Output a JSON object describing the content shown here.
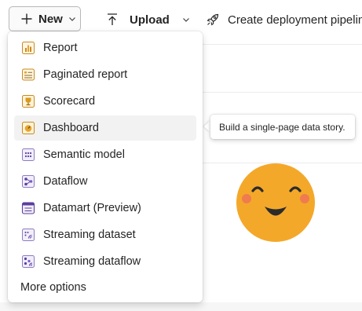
{
  "toolbar": {
    "new_label": "New",
    "upload_label": "Upload",
    "deploy_label": "Create deployment pipeline"
  },
  "menu": {
    "items": [
      {
        "label": "Report",
        "icon": "report-icon"
      },
      {
        "label": "Paginated report",
        "icon": "paginated-report-icon"
      },
      {
        "label": "Scorecard",
        "icon": "scorecard-trophy-icon"
      },
      {
        "label": "Dashboard",
        "icon": "dashboard-gauge-icon"
      },
      {
        "label": "Semantic model",
        "icon": "semantic-model-icon"
      },
      {
        "label": "Dataflow",
        "icon": "dataflow-icon"
      },
      {
        "label": "Datamart (Preview)",
        "icon": "datamart-icon"
      },
      {
        "label": "Streaming dataset",
        "icon": "streaming-dataset-icon"
      },
      {
        "label": "Streaming dataflow",
        "icon": "streaming-dataflow-icon"
      }
    ],
    "more_options": "More options"
  },
  "tooltip": {
    "text": "Build a single-page data story."
  },
  "colors": {
    "accent_orange": "#F4A82A",
    "accent_purple": "#5B3E9E",
    "cheek": "#EF7B4F"
  }
}
